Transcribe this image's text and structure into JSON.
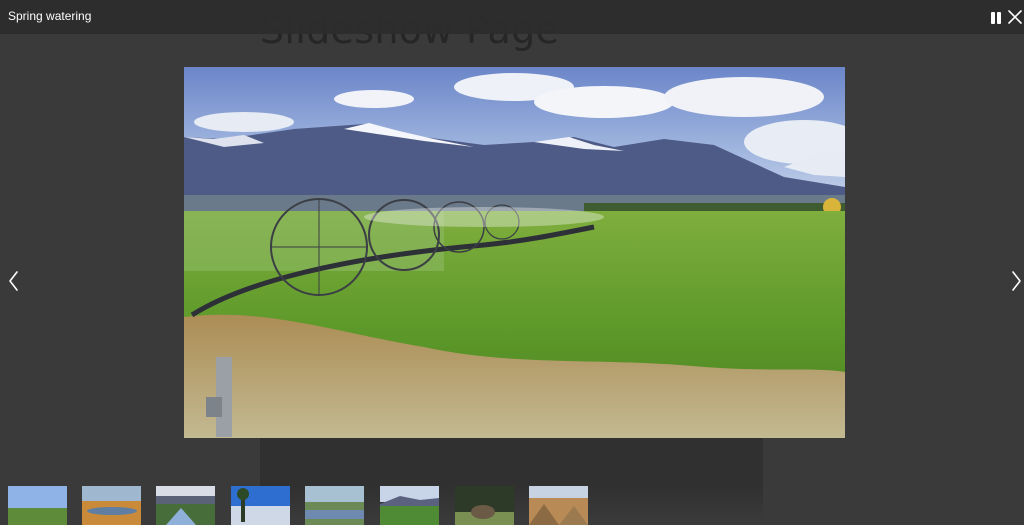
{
  "background_page": {
    "title": "Slideshow Page"
  },
  "viewer": {
    "caption": "Spring watering",
    "controls": {
      "pause_icon": "pause-icon",
      "close_icon": "close-icon",
      "prev_icon": "chevron-left-icon",
      "next_icon": "chevron-right-icon"
    },
    "colors": {
      "overlay": "#393939",
      "topbar": "#2c2c2c",
      "text": "#ffffff"
    }
  },
  "thumbnails": [
    {
      "scene": "meadow with sky"
    },
    {
      "scene": "autumn marsh"
    },
    {
      "scene": "river valley"
    },
    {
      "scene": "blue sky with trees"
    },
    {
      "scene": "pond with cattle"
    },
    {
      "scene": "green valley"
    },
    {
      "scene": "forest with bison"
    },
    {
      "scene": "rocky canyon"
    }
  ]
}
